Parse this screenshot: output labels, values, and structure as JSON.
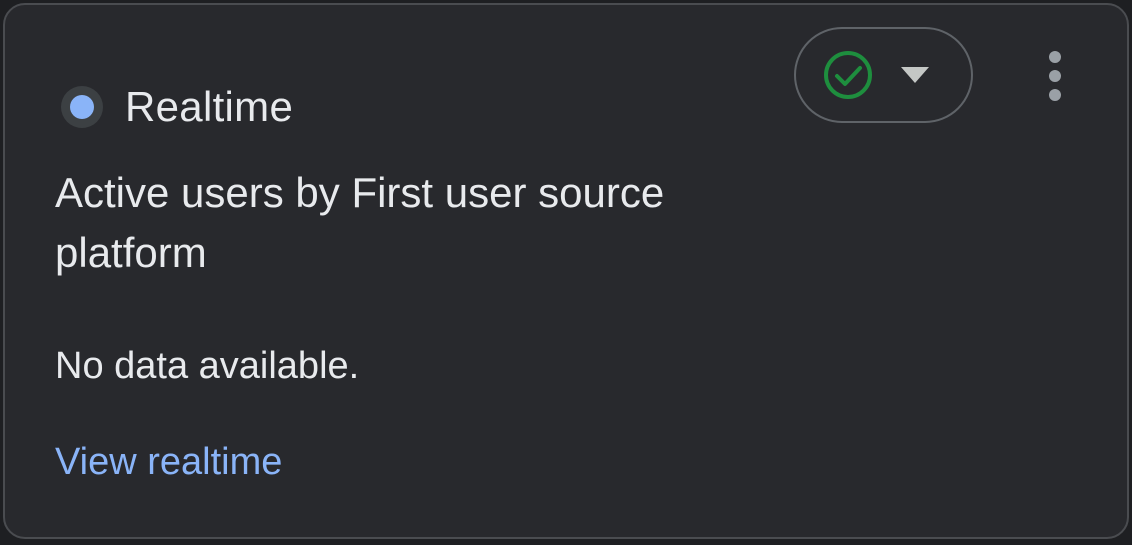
{
  "card": {
    "header_label": "Realtime",
    "title": "Active users by First user source platform",
    "empty_message": "No data available.",
    "link_label": "View realtime",
    "status_icon": "check-circle-icon",
    "dropdown_icon": "caret-down-icon",
    "menu_icon": "more-vert-icon",
    "colors": {
      "accent": "#8ab4f8",
      "status_ok": "#1e8e3e",
      "background": "#28292d"
    }
  }
}
